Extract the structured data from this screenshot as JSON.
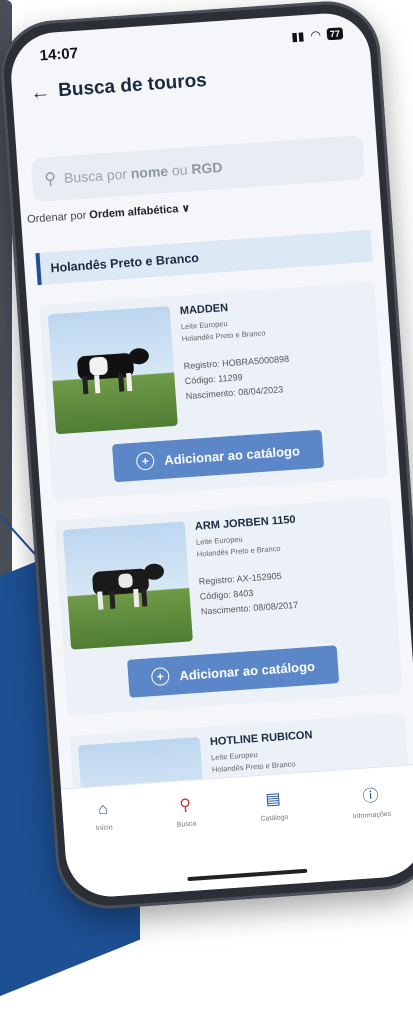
{
  "status": {
    "time": "14:07",
    "battery": "77"
  },
  "header": {
    "title": "Busca de touros"
  },
  "search": {
    "placeholder_pre": "Busca por ",
    "kw1": "nome",
    "mid": " ou ",
    "kw2": "RGD"
  },
  "sort": {
    "label": "Ordenar por ",
    "value": "Ordem alfabética ∨"
  },
  "category": "Holandês Preto e Branco",
  "add_label": "Adicionar ao catálogo",
  "bulls": [
    {
      "name": "MADDEN",
      "line1": "Leite Europeu",
      "line2": "Holandês Preto e Branco",
      "registro": "Registro: HOBRA5000898",
      "codigo": "Código: 11299",
      "nascimento": "Nascimento: 08/04/2023"
    },
    {
      "name": "ARM JORBEN 1150",
      "line1": "Leite Europeu",
      "line2": "Holandês Preto e Branco",
      "registro": "Registro: AX-152905",
      "codigo": "Código: 8403",
      "nascimento": "Nascimento: 08/08/2017"
    },
    {
      "name": "HOTLINE RUBICON",
      "line1": "Leite Europeu",
      "line2": "Holandês Preto e Branco"
    }
  ],
  "nav": [
    {
      "label": "Início",
      "icon": "home-icon"
    },
    {
      "label": "Busca",
      "icon": "search-icon"
    },
    {
      "label": "Catálogo",
      "icon": "catalog-icon"
    },
    {
      "label": "Informações",
      "icon": "info-icon"
    }
  ]
}
